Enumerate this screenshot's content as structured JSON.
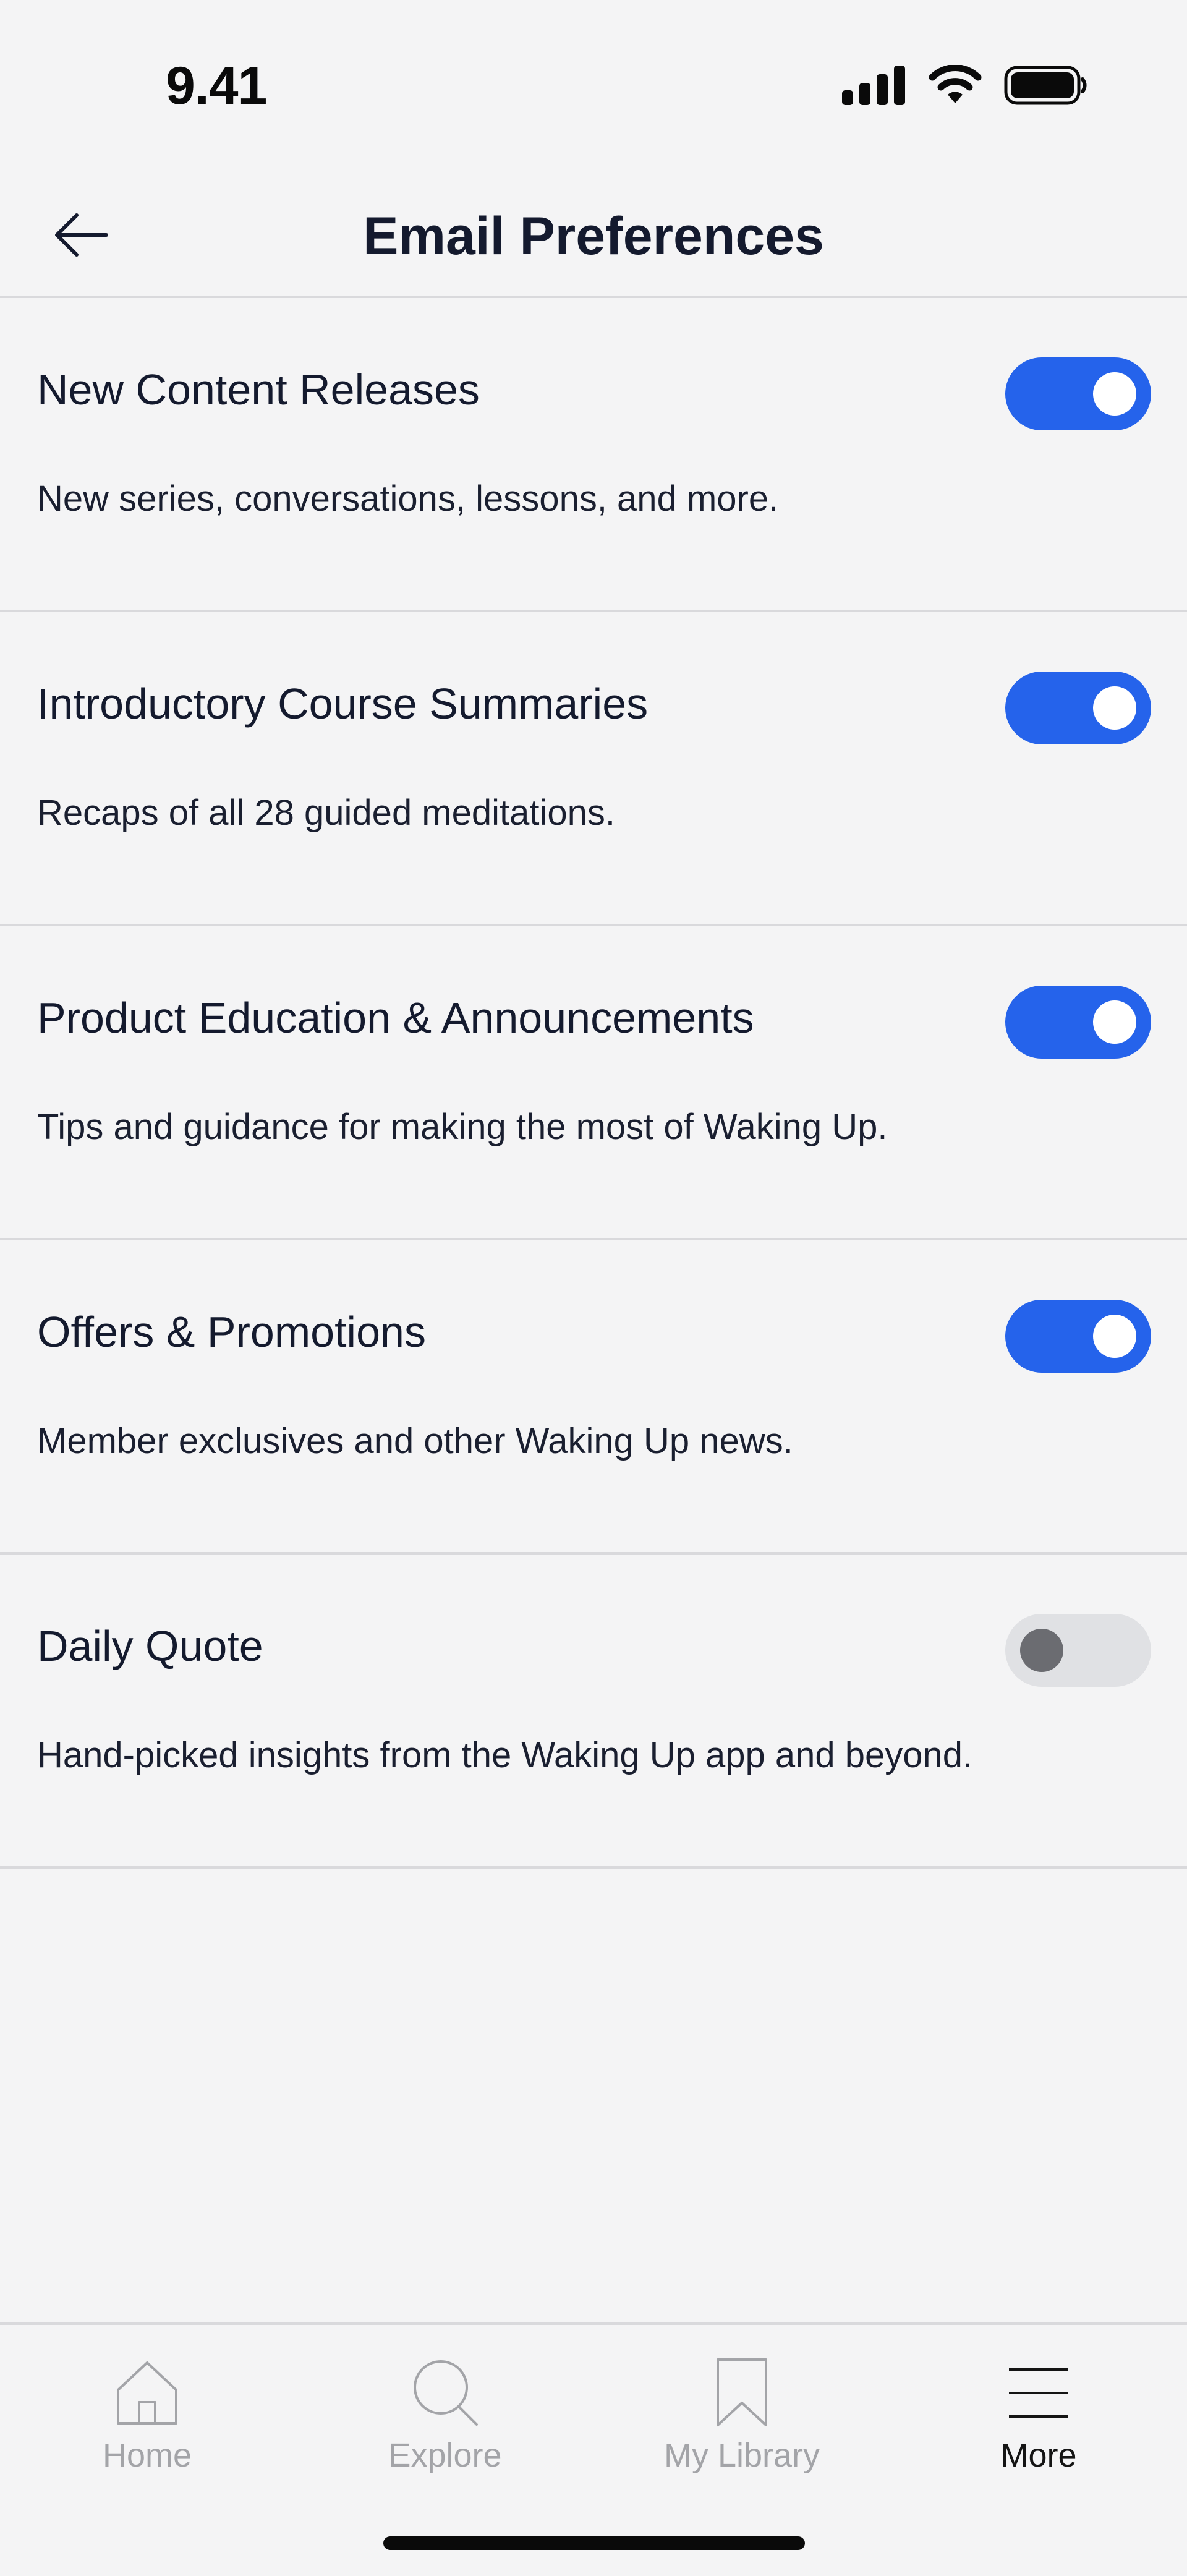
{
  "status_bar": {
    "time": "9.41",
    "icons": [
      "signal-icon",
      "wifi-icon",
      "battery-icon"
    ]
  },
  "header": {
    "title": "Email Preferences",
    "back_icon": "arrow-left-icon"
  },
  "colors": {
    "accent": "#2563eb",
    "background": "#f4f4f5",
    "text": "#141a2e",
    "divider": "#d9d9dc",
    "toggle_off": "#e0e1e4"
  },
  "preferences": [
    {
      "title": "New Content Releases",
      "description": "New series, conversations, lessons, and more.",
      "enabled": true
    },
    {
      "title": "Introductory Course Summaries",
      "description": "Recaps of all 28 guided meditations.",
      "enabled": true
    },
    {
      "title": "Product Education & Announcements",
      "description": "Tips and guidance for making the most of Waking Up.",
      "enabled": true
    },
    {
      "title": "Offers & Promotions",
      "description": "Member exclusives and other Waking Up news.",
      "enabled": true
    },
    {
      "title": "Daily Quote",
      "description": "Hand-picked insights from the Waking Up app and beyond.",
      "enabled": false
    }
  ],
  "tab_bar": {
    "tabs": [
      {
        "label": "Home",
        "icon": "home-icon",
        "active": false
      },
      {
        "label": "Explore",
        "icon": "search-icon",
        "active": false
      },
      {
        "label": "My Library",
        "icon": "bookmark-icon",
        "active": false
      },
      {
        "label": "More",
        "icon": "menu-icon",
        "active": true
      }
    ]
  }
}
